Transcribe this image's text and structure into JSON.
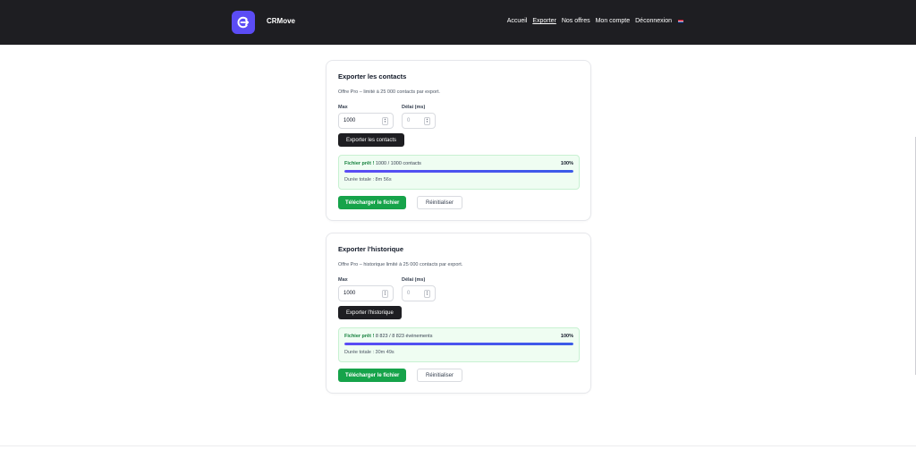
{
  "header": {
    "brand": "CRMove",
    "logo_icon": "crmove-logo-icon",
    "nav": [
      {
        "label": "Accueil",
        "active": false
      },
      {
        "label": "Exporter",
        "active": true
      },
      {
        "label": "Nos offres",
        "active": false
      },
      {
        "label": "Mon compte",
        "active": false
      },
      {
        "label": "Déconnexion",
        "active": false
      }
    ],
    "language_icon": "uk-flag-icon"
  },
  "contacts_card": {
    "title": "Exporter les contacts",
    "description": "Offre Pro – limité à 25 000 contacts par export.",
    "max_label": "Max",
    "max_value": "1000",
    "delay_label": "Délai (ms)",
    "delay_value": "0",
    "export_button": "Exporter les contacts",
    "status_strong": "Fichier prêt !",
    "status_detail": " 1000 / 1000 contacts",
    "percent_label": "100%",
    "progress": 1.0,
    "duration": "Durée totale : 8m 56s",
    "download_button": "Télécharger le fichier",
    "reset_button": "Réinitialiser"
  },
  "history_card": {
    "title": "Exporter l'historique",
    "description": "Offre Pro – historique limité à 25 000 contacts par export.",
    "max_label": "Max",
    "max_value": "1000",
    "delay_label": "Délai (ms)",
    "delay_value": "0",
    "export_button": "Exporter l'historique",
    "status_strong": "Fichier prêt !",
    "status_detail": " 8 823 / 8 823 événements",
    "percent_label": "100%",
    "progress": 1.0,
    "duration": "Durée totale : 30m 49s",
    "download_button": "Télécharger le fichier",
    "reset_button": "Réinitialiser"
  },
  "colors": {
    "header_bg": "#1e1e22",
    "accent": "#5b4cf5",
    "success": "#16a34a"
  }
}
